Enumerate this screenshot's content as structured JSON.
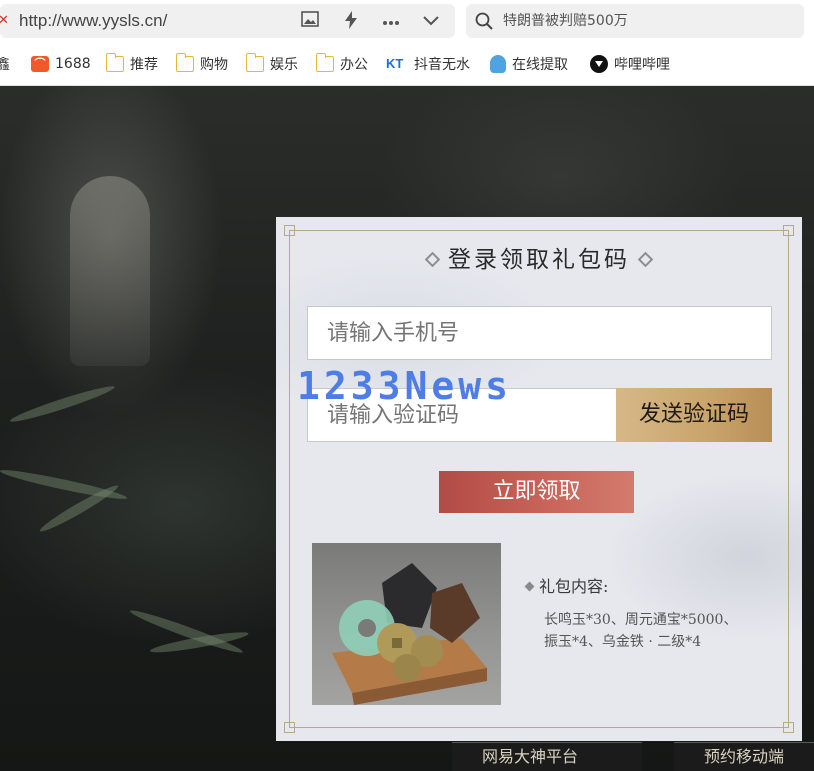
{
  "browser": {
    "url": "http://www.yysls.cn/",
    "search_text": "特朗普被判赔500万",
    "bookmarks": [
      {
        "label": "鑫",
        "icon": "bookmark-icon"
      },
      {
        "label": "1688",
        "icon": "alibaba-icon"
      },
      {
        "label": "推荐",
        "icon": "folder-icon"
      },
      {
        "label": "购物",
        "icon": "folder-icon"
      },
      {
        "label": "娱乐",
        "icon": "folder-icon"
      },
      {
        "label": "办公",
        "icon": "folder-icon"
      },
      {
        "label": "抖音无水",
        "icon": "kt-icon"
      },
      {
        "label": "在线提取",
        "icon": "ghost-icon"
      },
      {
        "label": "哔哩哔哩",
        "icon": "bilibili-icon"
      }
    ]
  },
  "login": {
    "title": "登录领取礼包码",
    "phone_placeholder": "请输入手机号",
    "code_placeholder": "请输入验证码",
    "send_code_label": "发送验证码",
    "claim_label": "立即领取"
  },
  "gift": {
    "title": "礼包内容:",
    "line1": "长鸣玉*30、周元通宝*5000、",
    "line2": "振玉*4、乌金铁 · 二级*4"
  },
  "footer": {
    "tab1": "网易大神平台",
    "tab2": "预约移动端"
  },
  "watermark": "1233News",
  "colors": {
    "accent_gold": "#c9a46a",
    "claim_red": "#c9645a",
    "panel_bg": "#e6e8ee",
    "watermark_blue": "#4f7de6"
  }
}
